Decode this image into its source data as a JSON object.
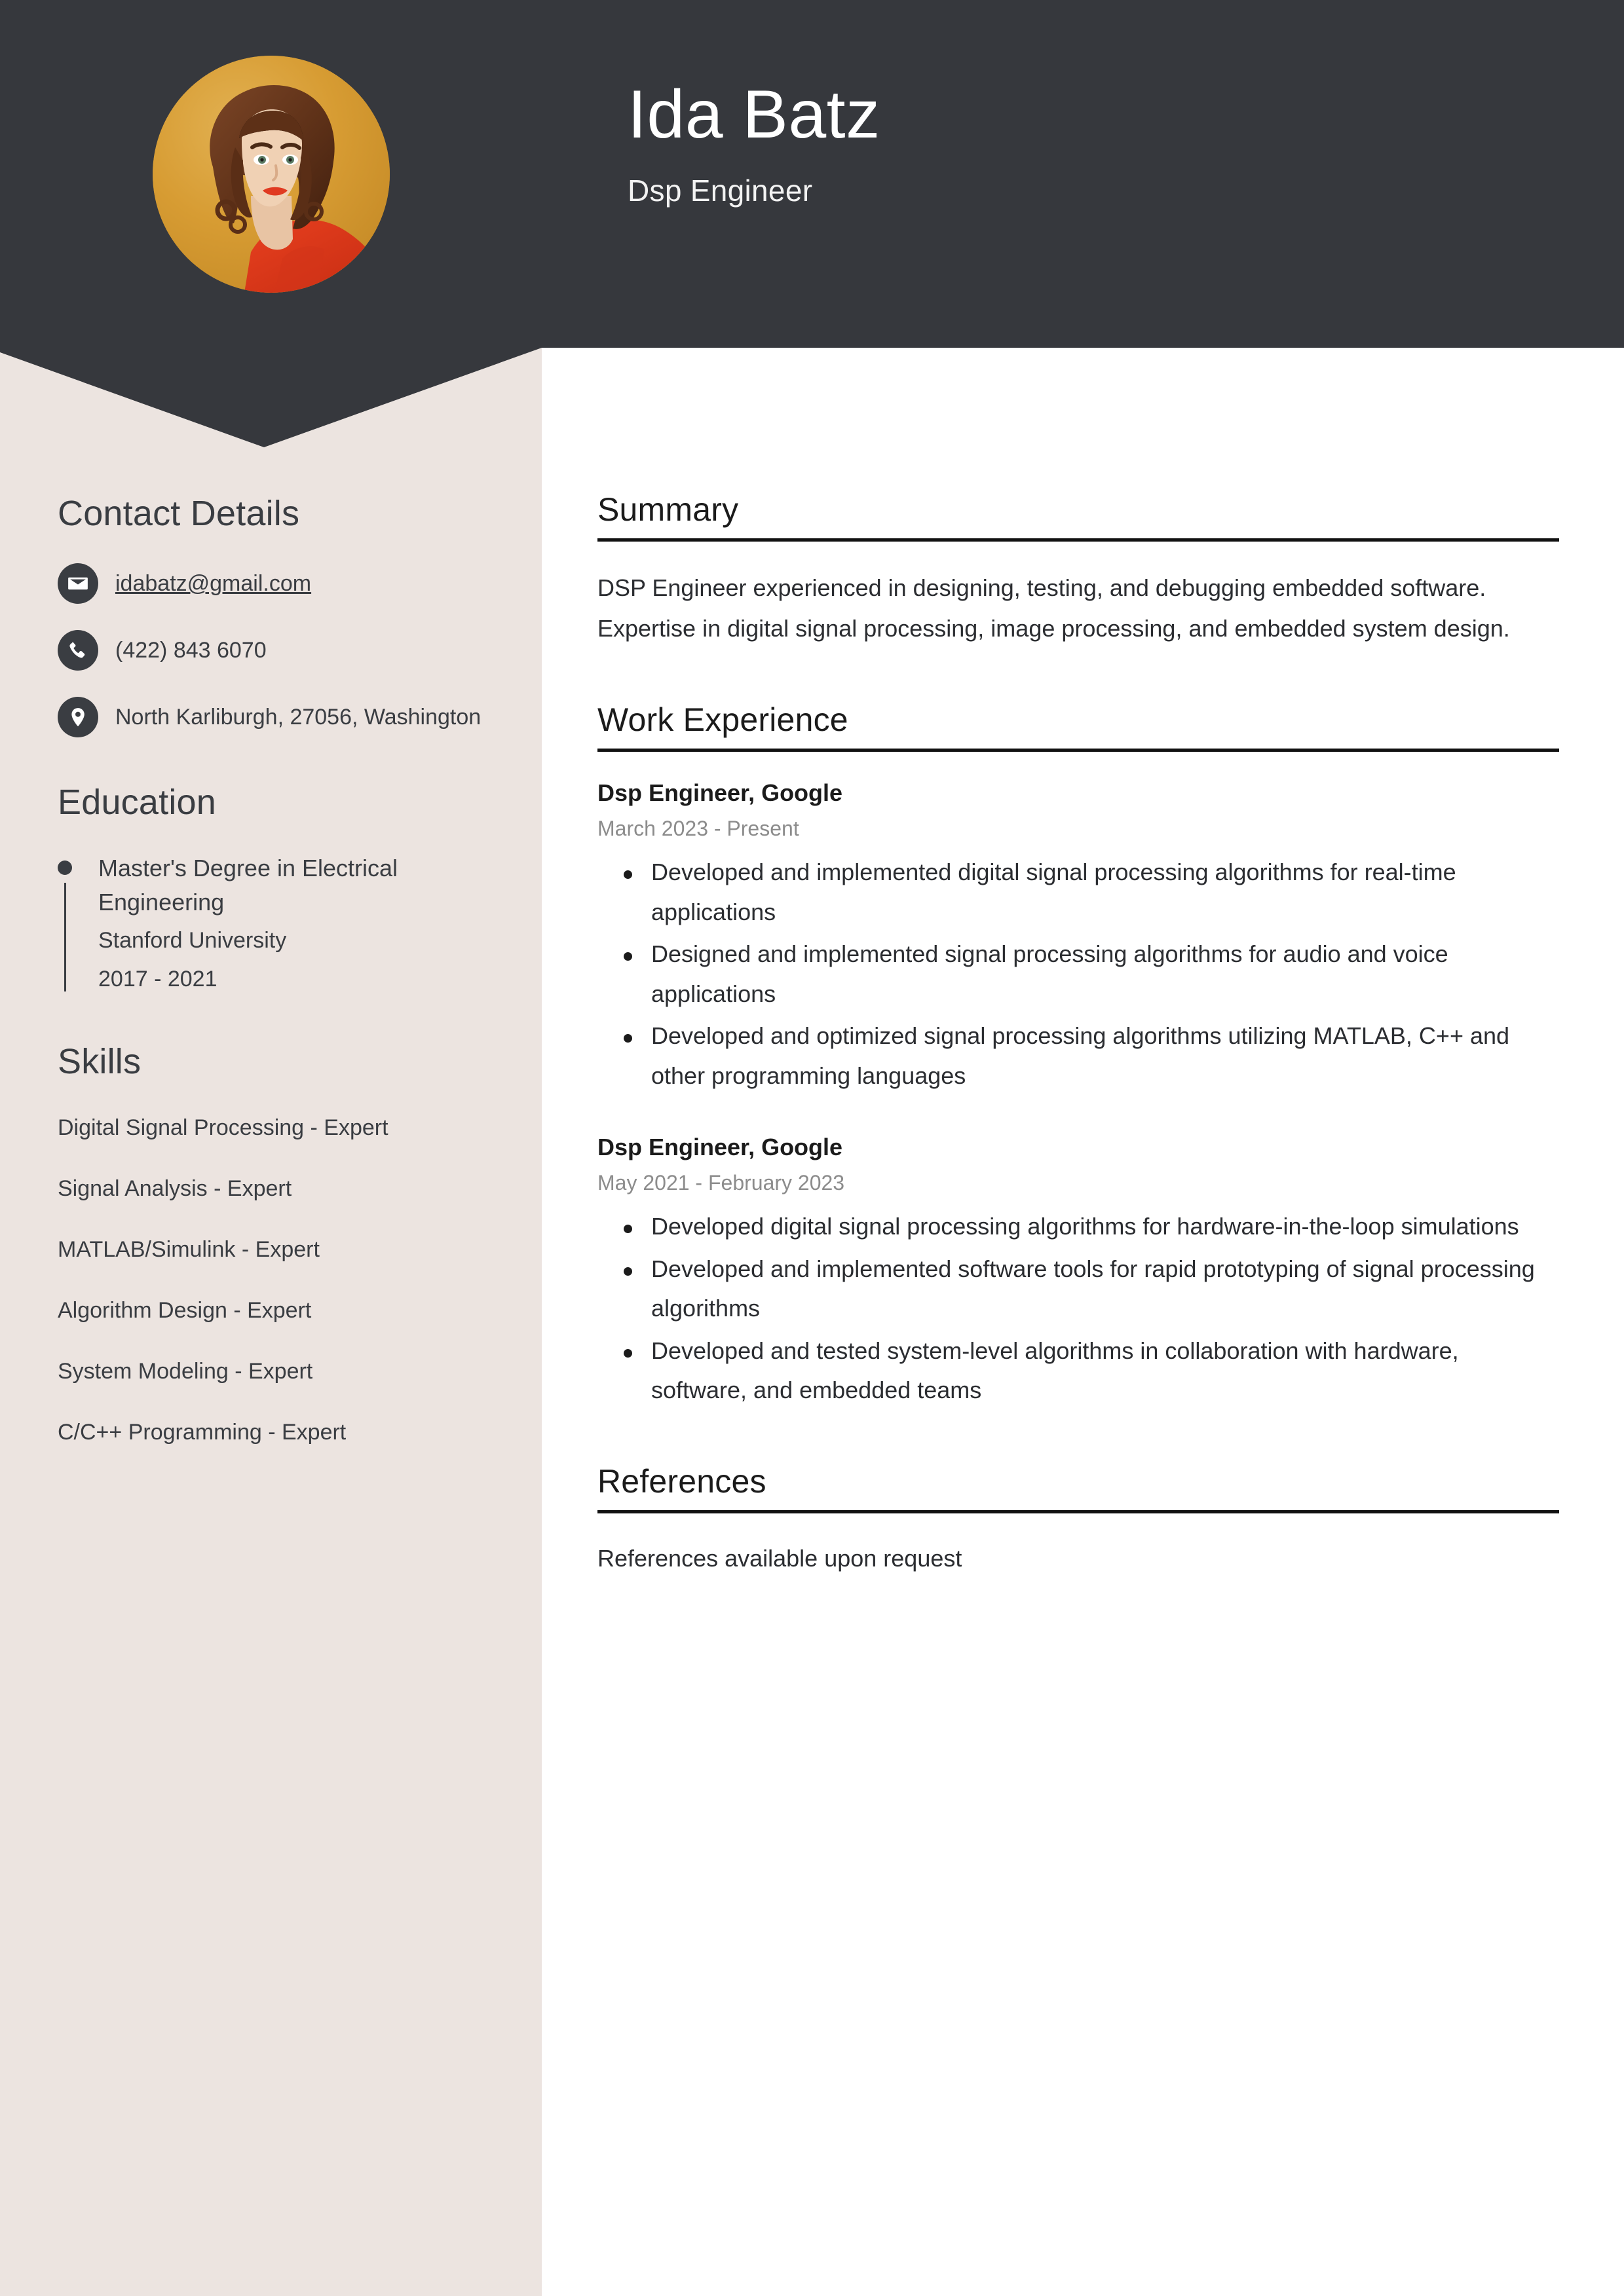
{
  "theme": {
    "header_bg": "#36383D",
    "sidebar_bg": "#ECE4E0",
    "page_bg": "#FFFFFF",
    "text": "#3A3D42",
    "muted": "#8C8C8C",
    "avatar_bg": "#D79C33",
    "rule": "#111111"
  },
  "header": {
    "name": "Ida Batz",
    "job_title": "Dsp Engineer",
    "avatar_alt": "profile-photo"
  },
  "sidebar": {
    "contact": {
      "heading": "Contact Details",
      "items": [
        {
          "icon": "envelope-icon",
          "value": "idabatz@gmail.com",
          "is_link": true
        },
        {
          "icon": "phone-icon",
          "value": "(422) 843 6070",
          "is_link": false
        },
        {
          "icon": "map-pin-icon",
          "value": "North Karliburgh, 27056, Washington",
          "is_link": false
        }
      ]
    },
    "education": {
      "heading": "Education",
      "items": [
        {
          "degree": "Master's Degree in Electrical Engineering",
          "school": "Stanford University",
          "dates": "2017 - 2021"
        }
      ]
    },
    "skills": {
      "heading": "Skills",
      "items": [
        "Digital Signal Processing - Expert",
        "Signal Analysis - Expert",
        "MATLAB/Simulink - Expert",
        "Algorithm Design - Expert",
        "System Modeling - Expert",
        "C/C++ Programming - Expert"
      ]
    }
  },
  "main": {
    "summary": {
      "heading": "Summary",
      "text": "DSP Engineer experienced in designing, testing, and debugging embedded software. Expertise in digital signal processing, image processing, and embedded system design."
    },
    "work_experience": {
      "heading": "Work Experience",
      "jobs": [
        {
          "title": "Dsp Engineer, Google",
          "dates": "March 2023 - Present",
          "bullets": [
            "Developed and implemented digital signal processing algorithms for real-time applications",
            "Designed and implemented signal processing algorithms for audio and voice applications",
            "Developed and optimized signal processing algorithms utilizing MATLAB, C++ and other programming languages"
          ]
        },
        {
          "title": "Dsp Engineer, Google",
          "dates": "May 2021 - February 2023",
          "bullets": [
            "Developed digital signal processing algorithms for hardware-in-the-loop simulations",
            "Developed and implemented software tools for rapid prototyping of signal processing algorithms",
            "Developed and tested system-level algorithms in collaboration with hardware, software, and embedded teams"
          ]
        }
      ]
    },
    "references": {
      "heading": "References",
      "text": "References available upon request"
    }
  }
}
